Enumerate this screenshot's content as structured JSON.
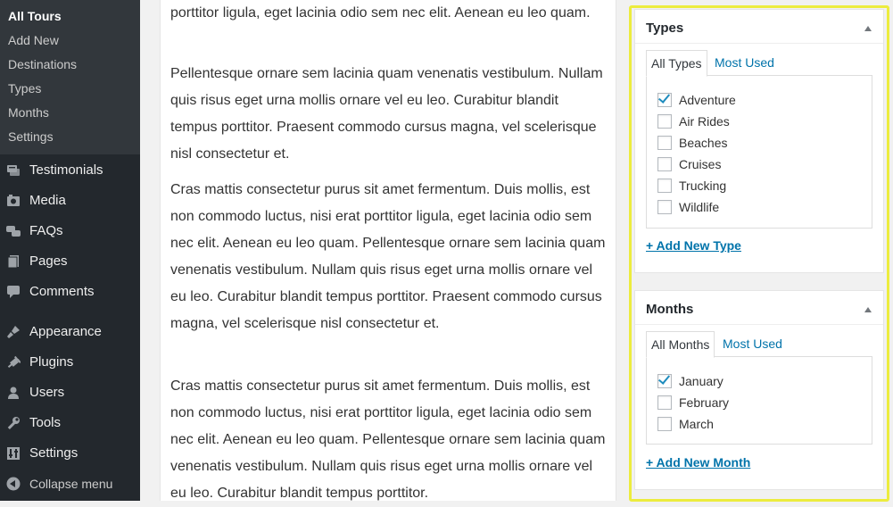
{
  "sidebar": {
    "submenu": [
      {
        "label": "All Tours"
      },
      {
        "label": "Add New"
      },
      {
        "label": "Destinations"
      },
      {
        "label": "Types"
      },
      {
        "label": "Months"
      },
      {
        "label": "Settings"
      }
    ],
    "menu": [
      {
        "label": "Testimonials",
        "icon": "testimonial-icon"
      },
      {
        "label": "Media",
        "icon": "media-icon"
      },
      {
        "label": "FAQs",
        "icon": "faqs-icon"
      },
      {
        "label": "Pages",
        "icon": "pages-icon"
      },
      {
        "label": "Comments",
        "icon": "comments-icon"
      },
      {
        "label": "Appearance",
        "icon": "appearance-icon"
      },
      {
        "label": "Plugins",
        "icon": "plugins-icon"
      },
      {
        "label": "Users",
        "icon": "users-icon"
      },
      {
        "label": "Tools",
        "icon": "tools-icon"
      },
      {
        "label": "Settings",
        "icon": "settings-icon"
      }
    ],
    "collapse_label": "Collapse menu"
  },
  "content": {
    "paragraphs": [
      "porttitor ligula, eget lacinia odio sem nec elit. Aenean eu leo quam.",
      "Pellentesque ornare sem lacinia quam venenatis vestibulum. Nullam quis risus eget urna mollis ornare vel eu leo. Curabitur blandit tempus porttitor. Praesent commodo cursus magna, vel scelerisque nisl consectetur et.",
      "Cras mattis consectetur purus sit amet fermentum. Duis mollis, est non commodo luctus, nisi erat porttitor ligula, eget lacinia odio sem nec elit. Aenean eu leo quam. Pellentesque ornare sem lacinia quam venenatis vestibulum. Nullam quis risus eget urna mollis ornare vel eu leo. Curabitur blandit tempus porttitor. Praesent commodo cursus magna, vel scelerisque nisl consectetur et.",
      "Cras mattis consectetur purus sit amet fermentum. Duis mollis, est non commodo luctus, nisi erat porttitor ligula, eget lacinia odio sem nec elit. Aenean eu leo quam. Pellentesque ornare sem lacinia quam venenatis vestibulum. Nullam quis risus eget urna mollis ornare vel eu leo. Curabitur blandit tempus porttitor."
    ]
  },
  "types_box": {
    "title": "Types",
    "tab_all": "All Types",
    "tab_most_used": "Most Used",
    "items": [
      {
        "label": "Adventure",
        "checked": true
      },
      {
        "label": "Air Rides",
        "checked": false
      },
      {
        "label": "Beaches",
        "checked": false
      },
      {
        "label": "Cruises",
        "checked": false
      },
      {
        "label": "Trucking",
        "checked": false
      },
      {
        "label": "Wildlife",
        "checked": false
      }
    ],
    "add_link": "+ Add New Type"
  },
  "months_box": {
    "title": "Months",
    "tab_all": "All Months",
    "tab_most_used": "Most Used",
    "items": [
      {
        "label": "January",
        "checked": true
      },
      {
        "label": "February",
        "checked": false
      },
      {
        "label": "March",
        "checked": false
      }
    ],
    "add_link": "+ Add New Month"
  },
  "colors": {
    "sidebar_bg": "#23282d",
    "submenu_bg": "#32373c",
    "link": "#0073aa",
    "highlight": "#ecec3e",
    "checkmark": "#1e8cbe"
  }
}
